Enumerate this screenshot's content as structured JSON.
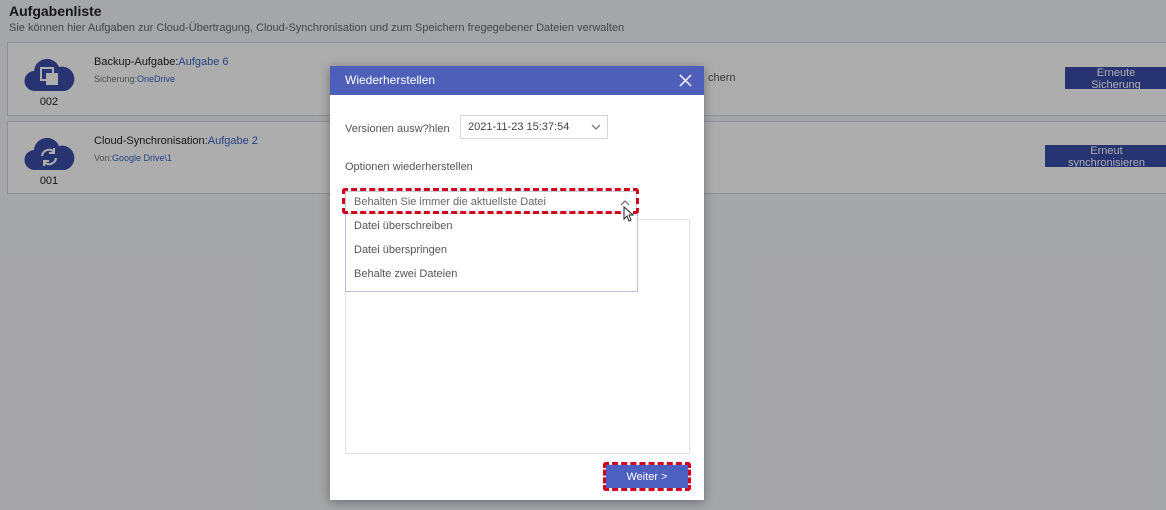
{
  "page": {
    "title": "Aufgabenliste",
    "subtitle": "Sie können hier Aufgaben zur Cloud-Übertragung, Cloud-Synchronisation und zum Speichern fregegebener Dateien verwalten"
  },
  "tasks": [
    {
      "number": "002",
      "type_label": "Backup-Aufgabe:",
      "name": "Aufgabe 6",
      "sub_label": "Sicherung:",
      "sub_value": "OneDrive",
      "status_fragment": "chern",
      "button_label": "Erneute Sicherung",
      "icon": "cloud-backup-icon"
    },
    {
      "number": "001",
      "type_label": "Cloud-Synchronisation:",
      "name": "Aufgabe 2",
      "sub_label": "Von:",
      "sub_value": "Google Drive\\1",
      "button_label": "Erneut synchronisieren",
      "icon": "cloud-sync-icon"
    }
  ],
  "dialog": {
    "title": "Wiederherstellen",
    "versions_label": "Versionen ausw?hlen",
    "version_selected": "2021-11-23 15:37:54",
    "options_label": "Optionen wiederherstellen",
    "option_selected": "Behalten Sie immer die aktuellste Datei",
    "menu_items": [
      "Datei überschreiben",
      "Datei überspringen",
      "Behalte zwei Dateien"
    ],
    "next_label": "Weiter >"
  },
  "colors": {
    "accent": "#3c4da8",
    "dialog_header": "#4d5fb8",
    "link": "#3b63c2",
    "highlight": "#d0001c"
  }
}
